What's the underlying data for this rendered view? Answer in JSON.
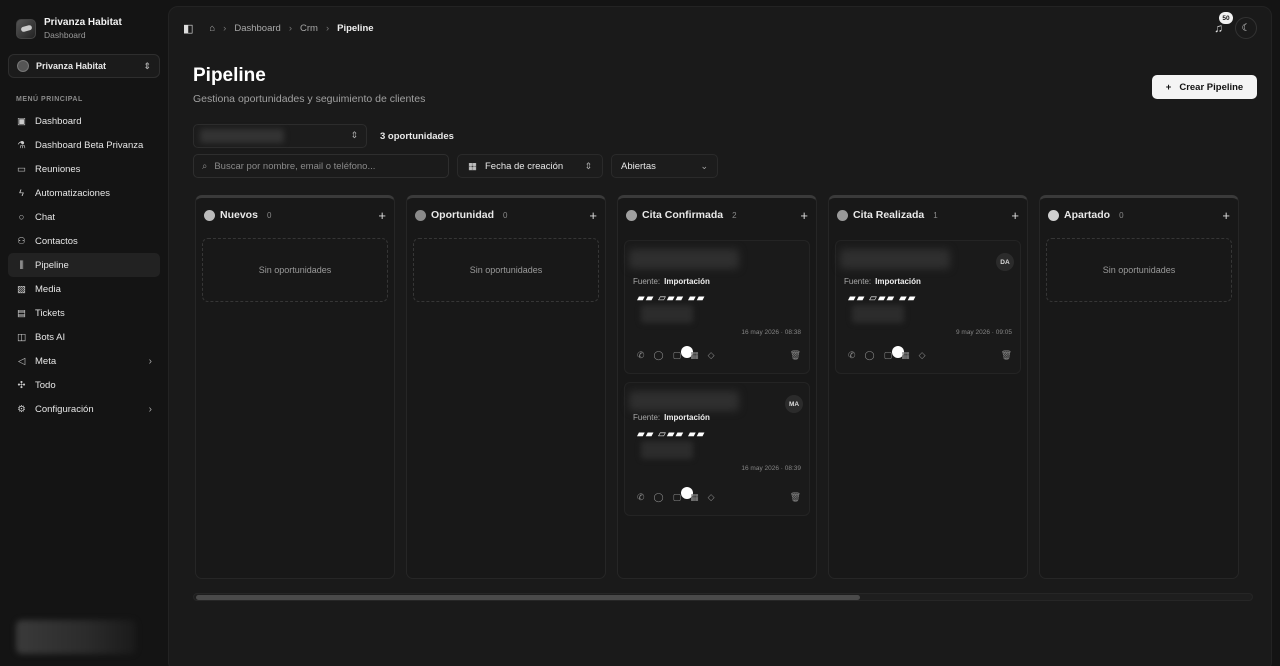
{
  "sidebar": {
    "brand_name": "Privanza Habitat",
    "brand_sub": "Dashboard",
    "org_name": "Privanza Habitat",
    "menu_title": "MENÚ PRINCIPAL",
    "items": [
      {
        "label": "Dashboard",
        "icon": "dashboard-icon"
      },
      {
        "label": "Dashboard Beta Privanza",
        "icon": "flask-icon"
      },
      {
        "label": "Reuniones",
        "icon": "video-icon"
      },
      {
        "label": "Automatizaciones",
        "icon": "bolt-icon"
      },
      {
        "label": "Chat",
        "icon": "chat-icon"
      },
      {
        "label": "Contactos",
        "icon": "users-icon"
      },
      {
        "label": "Pipeline",
        "icon": "kanban-icon"
      },
      {
        "label": "Media",
        "icon": "image-icon"
      },
      {
        "label": "Tickets",
        "icon": "ticket-icon"
      },
      {
        "label": "Bots AI",
        "icon": "bot-icon"
      },
      {
        "label": "Meta",
        "icon": "megaphone-icon"
      },
      {
        "label": "Todo",
        "icon": "todo-icon"
      },
      {
        "label": "Configuración",
        "icon": "gear-icon"
      }
    ]
  },
  "topbar": {
    "crumbs": [
      "Dashboard",
      "Crm",
      "Pipeline"
    ],
    "notifications": "50"
  },
  "page": {
    "title": "Pipeline",
    "subtitle": "Gestiona oportunidades y seguimiento de clientes",
    "create_label": "Crear Pipeline",
    "opp_count": "3 oportunidades",
    "search_placeholder": "Buscar por nombre, email o teléfono...",
    "date_label": "Fecha de creación",
    "status_value": "Abiertas"
  },
  "columns": [
    {
      "name": "Nuevos",
      "count": "0",
      "empty": "Sin oportunidades"
    },
    {
      "name": "Oportunidad",
      "count": "0",
      "empty": "Sin oportunidades"
    },
    {
      "name": "Cita Confirmada",
      "count": "2"
    },
    {
      "name": "Cita Realizada",
      "count": "1"
    },
    {
      "name": "Apartado",
      "count": "0",
      "empty": "Sin oportunidades"
    }
  ],
  "cards": [
    {
      "source_label": "Fuente:",
      "source": "Importación",
      "date": "16 may 2026 · 08:38",
      "avatar": ""
    },
    {
      "source_label": "Fuente:",
      "source": "Importación",
      "date": "16 may 2026 · 08:39",
      "avatar": "MA"
    },
    {
      "source_label": "Fuente:",
      "source": "Importación",
      "date": "9 may 2026 · 09:05",
      "avatar": "DA"
    }
  ]
}
